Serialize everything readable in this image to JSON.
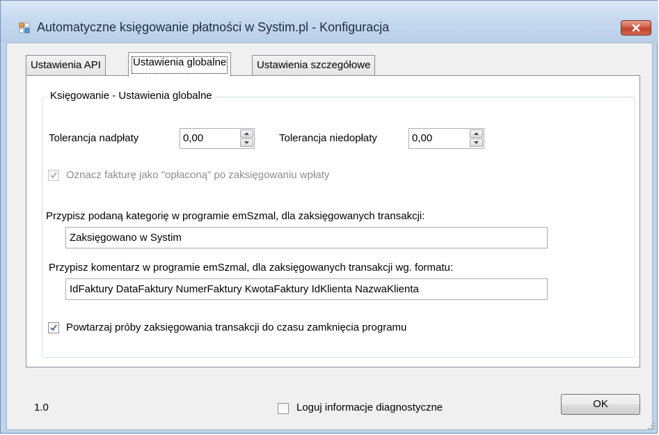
{
  "window": {
    "title": "Automatyczne księgowanie płatności w Systim.pl - Konfiguracja",
    "close_symbol": "✕"
  },
  "tabs": [
    {
      "label": "Ustawienia API",
      "active": false
    },
    {
      "label": "Ustawienia globalne",
      "active": true
    },
    {
      "label": "Ustawienia szczegółowe",
      "active": false
    }
  ],
  "group": {
    "title": "Księgowanie - Ustawienia globalne"
  },
  "tolerance": {
    "overpay_label": "Tolerancja nadpłaty",
    "overpay_value": "0,00",
    "underpay_label": "Tolerancja niedopłaty",
    "underpay_value": "0,00"
  },
  "mark_paid": {
    "label": "Oznacz fakturę jako \"opłaconą\" po zaksięgowaniu wpłaty",
    "checked": true,
    "enabled": false
  },
  "category": {
    "label": "Przypisz podaną kategorię w programie emSzmal, dla zaksięgowanych transakcji:",
    "value": "Zaksięgowano w Systim"
  },
  "comment": {
    "label": "Przypisz komentarz w programie emSzmal, dla zaksięgowanych transakcji wg. formatu:",
    "value": "IdFaktury DataFaktury NumerFaktury KwotaFaktury IdKlienta NazwaKlienta"
  },
  "retry": {
    "label": "Powtarzaj próby zaksięgowania transakcji do czasu zamknięcia programu",
    "checked": true
  },
  "footer": {
    "version": "1.0",
    "diagnostics_label": "Loguj informacje diagnostyczne",
    "diagnostics_checked": false,
    "ok_label": "OK"
  },
  "colors": {
    "titlebar": "#c5d8ee",
    "close_button": "#c7462f",
    "checkmark": "#4a6fa5",
    "disabled_text": "#8d8d8d"
  }
}
